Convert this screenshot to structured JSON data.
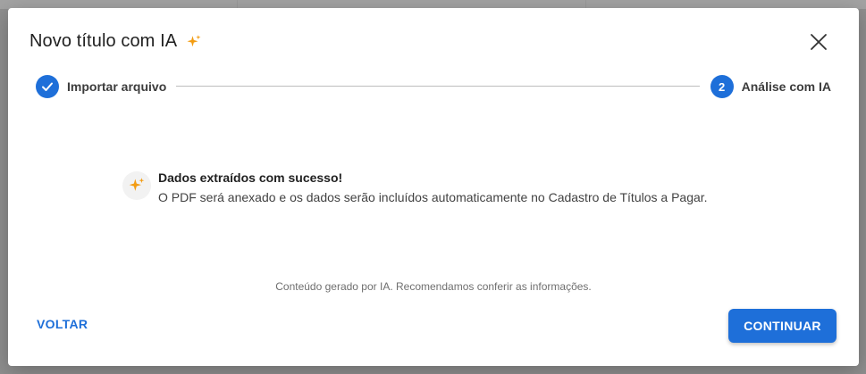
{
  "dialog": {
    "title": "Novo título com IA",
    "title_icon": "sparkle-icon",
    "close_icon": "close-icon"
  },
  "stepper": {
    "steps": [
      {
        "label": "Importar arquivo",
        "state": "completed",
        "icon": "check-icon"
      },
      {
        "label": "Análise com IA",
        "state": "active",
        "number": "2"
      }
    ]
  },
  "result": {
    "icon": "sparkle-icon",
    "title": "Dados extraídos com sucesso!",
    "message": "O PDF será anexado e os dados serão incluídos automaticamente no Cadastro de Títulos a Pagar."
  },
  "disclaimer": "Conteúdo gerado por IA. Recomendamos conferir as informações.",
  "actions": {
    "back_label": "VOLTAR",
    "continue_label": "CONTINUAR"
  },
  "colors": {
    "primary": "#1e6fd9",
    "accent": "#f39c12"
  }
}
